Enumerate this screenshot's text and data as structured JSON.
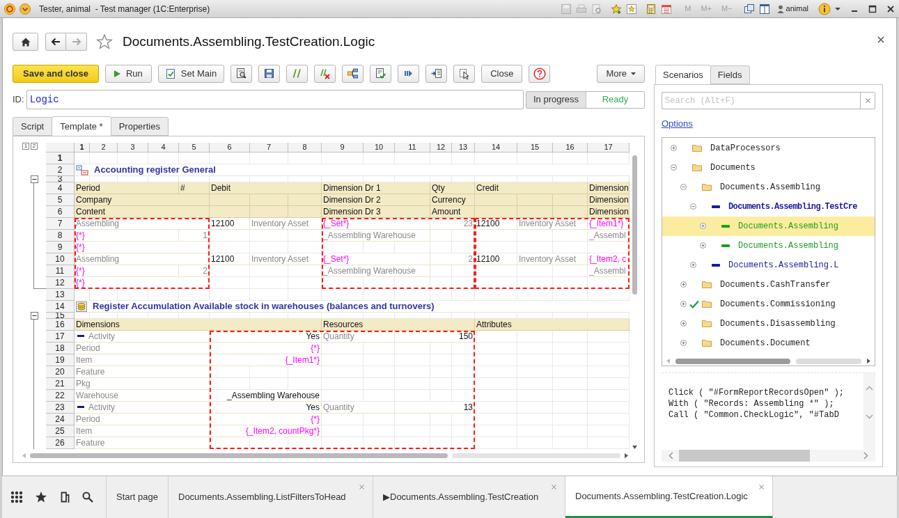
{
  "window": {
    "title": "Tester, animal  - Test manager (1C:Enterprise)",
    "memory_buttons": [
      "M",
      "M+",
      "M−"
    ],
    "user": "animal"
  },
  "form": {
    "title": "Documents.Assembling.TestCreation.Logic",
    "toolbar": {
      "save": "Save and close",
      "run": "Run",
      "set_main": "Set Main",
      "close": "Close",
      "more": "More"
    },
    "id_label": "ID:",
    "id_value": "Logic",
    "status_options": [
      {
        "label": "In progress",
        "selected": true
      },
      {
        "label": "Ready",
        "selected": false
      }
    ],
    "tabs": [
      {
        "label": "Script",
        "selected": false
      },
      {
        "label": "Template *",
        "selected": true
      },
      {
        "label": "Properties",
        "selected": false
      }
    ],
    "sheet": {
      "levels": [
        "1",
        "2"
      ],
      "columns": [
        {
          "label": "1",
          "selected": true
        },
        {
          "label": "2",
          "selected": false
        },
        {
          "label": "3",
          "selected": false
        },
        {
          "label": "4",
          "selected": false
        },
        {
          "label": "5",
          "selected": false
        },
        {
          "label": "6",
          "selected": false
        },
        {
          "label": "7",
          "selected": false
        },
        {
          "label": "8",
          "selected": false
        },
        {
          "label": "9",
          "selected": false
        },
        {
          "label": "10",
          "selected": false
        },
        {
          "label": "11",
          "selected": false
        },
        {
          "label": "12",
          "selected": false
        },
        {
          "label": "13",
          "selected": false
        },
        {
          "label": "14",
          "selected": false
        },
        {
          "label": "15",
          "selected": false
        },
        {
          "label": "16",
          "selected": false
        },
        {
          "label": "17",
          "selected": false
        }
      ],
      "rows": [
        {
          "number": "1",
          "kind": "blank",
          "selected": true
        },
        {
          "number": "2",
          "kind": "data",
          "selected": false,
          "cells": [
            {
              "text": "Accounting register General",
              "kind": "accounting_title"
            }
          ]
        },
        {
          "number": "3",
          "kind": "thin",
          "selected": false
        },
        {
          "number": "4",
          "kind": "header",
          "selected": false,
          "cells": [
            {
              "text": "Period",
              "kind": "header"
            },
            {
              "text": "#",
              "kind": "header"
            },
            {
              "text": "Debit",
              "kind": "header"
            },
            {
              "text": "Dimension Dr 1",
              "kind": "header"
            },
            {
              "text": "Qty",
              "kind": "header"
            },
            {
              "text": "Credit",
              "kind": "header"
            },
            {
              "text": "Dimension",
              "kind": "header"
            }
          ]
        },
        {
          "number": "5",
          "kind": "header",
          "selected": false,
          "cells": [
            {
              "text": "Company",
              "kind": "header"
            },
            {
              "text": "Dimension Dr 2",
              "kind": "header"
            },
            {
              "text": "Currency",
              "kind": "header"
            },
            {
              "text": "Dimension",
              "kind": "header"
            }
          ]
        },
        {
          "number": "6",
          "kind": "header",
          "selected": false,
          "cells": [
            {
              "text": "Content",
              "kind": "header"
            },
            {
              "text": "Dimension Dr 3",
              "kind": "header"
            },
            {
              "text": "Amount",
              "kind": "header"
            },
            {
              "text": "Dimension",
              "kind": "header"
            }
          ]
        },
        {
          "number": "7",
          "kind": "data",
          "selected": false,
          "cells": [
            {
              "text": "Assembling",
              "kind": "field"
            },
            {
              "text": "12100",
              "kind": "value"
            },
            {
              "text": "Inventory Asset",
              "kind": "field"
            },
            {
              "text": "{_Set*}",
              "kind": "param"
            },
            {
              "text": "23",
              "kind": "field"
            },
            {
              "text": "12100",
              "kind": "value"
            },
            {
              "text": "Inventory Asset",
              "kind": "field"
            },
            {
              "text": "{_Item1*}",
              "kind": "param"
            }
          ]
        },
        {
          "number": "8",
          "kind": "data",
          "selected": false,
          "cells": [
            {
              "text": "{*}",
              "kind": "param"
            },
            {
              "text": "1",
              "kind": "field"
            },
            {
              "text": "_Assembling Warehouse",
              "kind": "field"
            },
            {
              "text": "_Assembl",
              "kind": "field"
            }
          ]
        },
        {
          "number": "9",
          "kind": "data",
          "selected": false,
          "cells": [
            {
              "text": "{*}",
              "kind": "param"
            }
          ]
        },
        {
          "number": "10",
          "kind": "data",
          "selected": false,
          "cells": [
            {
              "text": "Assembling",
              "kind": "field"
            },
            {
              "text": "12100",
              "kind": "value"
            },
            {
              "text": "Inventory Asset",
              "kind": "field"
            },
            {
              "text": "{_Set*}",
              "kind": "param"
            },
            {
              "text": "2",
              "kind": "field"
            },
            {
              "text": "12100",
              "kind": "value"
            },
            {
              "text": "Inventory Asset",
              "kind": "field"
            },
            {
              "text": "{_Item2, c",
              "kind": "param"
            }
          ]
        },
        {
          "number": "11",
          "kind": "data",
          "selected": false,
          "cells": [
            {
              "text": "{*}",
              "kind": "param"
            },
            {
              "text": "2",
              "kind": "field"
            },
            {
              "text": "_Assembling Warehouse",
              "kind": "field"
            },
            {
              "text": "_Assembl",
              "kind": "field"
            }
          ]
        },
        {
          "number": "12",
          "kind": "data",
          "selected": false,
          "cells": [
            {
              "text": "{*}",
              "kind": "param"
            }
          ]
        },
        {
          "number": "13",
          "kind": "blank",
          "selected": false
        },
        {
          "number": "14",
          "kind": "data",
          "selected": false,
          "cells": [
            {
              "text": "Register Accumulation Available stock in warehouses (balances and turnovers)",
              "kind": "accumulation_title"
            }
          ]
        },
        {
          "number": "15",
          "kind": "thin",
          "selected": false
        },
        {
          "number": "16",
          "kind": "header",
          "selected": false,
          "cells": [
            {
              "text": "Dimensions",
              "kind": "header"
            },
            {
              "text": "Resources",
              "kind": "header"
            },
            {
              "text": "Attributes",
              "kind": "header"
            }
          ]
        },
        {
          "number": "17",
          "kind": "data",
          "selected": false,
          "cells": [
            {
              "text": "Activity",
              "kind": "group"
            },
            {
              "text": "Yes",
              "kind": "value"
            },
            {
              "text": "Quantity",
              "kind": "field"
            },
            {
              "text": "150",
              "kind": "value"
            }
          ]
        },
        {
          "number": "18",
          "kind": "data",
          "selected": false,
          "cells": [
            {
              "text": "Period",
              "kind": "field"
            },
            {
              "text": "{*}",
              "kind": "param"
            }
          ]
        },
        {
          "number": "19",
          "kind": "data",
          "selected": false,
          "cells": [
            {
              "text": "Item",
              "kind": "field"
            },
            {
              "text": "{_Item1*}",
              "kind": "param"
            }
          ]
        },
        {
          "number": "20",
          "kind": "data",
          "selected": false,
          "cells": [
            {
              "text": "Feature",
              "kind": "field"
            }
          ]
        },
        {
          "number": "21",
          "kind": "data",
          "selected": false,
          "cells": [
            {
              "text": "Pkg",
              "kind": "field"
            }
          ]
        },
        {
          "number": "22",
          "kind": "data",
          "selected": false,
          "cells": [
            {
              "text": "Warehouse",
              "kind": "field"
            },
            {
              "text": "_Assembling Warehouse",
              "kind": "value"
            }
          ]
        },
        {
          "number": "23",
          "kind": "data",
          "selected": false,
          "cells": [
            {
              "text": "Activity",
              "kind": "group"
            },
            {
              "text": "Yes",
              "kind": "value"
            },
            {
              "text": "Quantity",
              "kind": "field"
            },
            {
              "text": "13",
              "kind": "value"
            }
          ]
        },
        {
          "number": "24",
          "kind": "data",
          "selected": false,
          "cells": [
            {
              "text": "Period",
              "kind": "field"
            },
            {
              "text": "{*}",
              "kind": "param"
            }
          ]
        },
        {
          "number": "25",
          "kind": "data",
          "selected": false,
          "cells": [
            {
              "text": "Item",
              "kind": "field"
            },
            {
              "text": "{_Item2, countPkg*}",
              "kind": "param"
            }
          ]
        },
        {
          "number": "26",
          "kind": "data",
          "selected": false,
          "cells": [
            {
              "text": "Feature",
              "kind": "field"
            }
          ]
        }
      ]
    }
  },
  "side_panel": {
    "tabs": [
      {
        "label": "Scenarios",
        "selected": true
      },
      {
        "label": "Fields",
        "selected": false
      }
    ],
    "search": {
      "placeholder": "Search (Alt+F)"
    },
    "options_link": "Options",
    "tree": [
      {
        "label": "DataProcessors",
        "kind": "folder",
        "expanded": false,
        "checked": false,
        "selected": false,
        "emphasized": false
      },
      {
        "label": "Documents",
        "kind": "folder",
        "expanded": true,
        "checked": false,
        "selected": false,
        "emphasized": false,
        "children": [
          {
            "label": "Documents.Assembling",
            "kind": "folder",
            "expanded": true,
            "checked": false,
            "selected": false,
            "emphasized": false,
            "children": [
              {
                "label": "Documents.Assembling.TestCre",
                "kind": "scenario",
                "color": "#1a1a9e",
                "expanded": true,
                "checked": false,
                "selected": false,
                "emphasized": true,
                "children": [
                  {
                    "label": "Documents.Assembling",
                    "kind": "scenario",
                    "color": "#1f9d1f",
                    "expanded": false,
                    "checked": false,
                    "selected": true,
                    "emphasized": false
                  },
                  {
                    "label": "Documents.Assembling",
                    "kind": "scenario",
                    "color": "#1f9d1f",
                    "expanded": false,
                    "checked": false,
                    "selected": false,
                    "emphasized": false
                  }
                ]
              },
              {
                "label": "Documents.Assembling.L",
                "kind": "scenario",
                "color": "#1a1a9e",
                "expanded": false,
                "checked": false,
                "selected": false,
                "emphasized": false
              }
            ]
          },
          {
            "label": "Documents.CashTransfer",
            "kind": "folder",
            "expanded": false,
            "checked": false,
            "selected": false,
            "emphasized": false
          },
          {
            "label": "Documents.Commissioning",
            "kind": "folder",
            "expanded": false,
            "checked": true,
            "selected": false,
            "emphasized": false
          },
          {
            "label": "Documents.Disassembling",
            "kind": "folder",
            "expanded": false,
            "checked": false,
            "selected": false,
            "emphasized": false
          },
          {
            "label": "Documents.Document",
            "kind": "folder",
            "expanded": false,
            "checked": false,
            "selected": false,
            "emphasized": false
          }
        ]
      }
    ],
    "code": [
      "Click ( \"#FormReportRecordsOpen\" );",
      "With ( \"Records: Assembling *\" );",
      "Call ( \"Common.CheckLogic\", \"#TabD"
    ]
  },
  "taskbar": {
    "tabs": [
      {
        "label": "Start page",
        "selected": false,
        "closable": false
      },
      {
        "label": "Documents.Assembling.ListFiltersToHead",
        "selected": false,
        "closable": true
      },
      {
        "label": "▶Documents.Assembling.TestCreation",
        "selected": false,
        "closable": true
      },
      {
        "label": "Documents.Assembling.TestCreation.Logic",
        "selected": true,
        "closable": true
      }
    ]
  }
}
